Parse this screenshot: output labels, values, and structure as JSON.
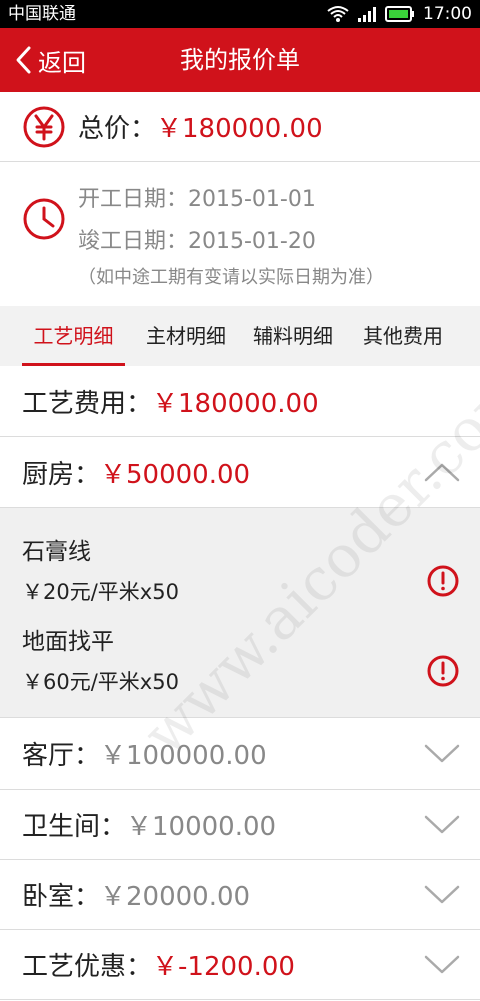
{
  "status_bar": {
    "carrier": "中国联通",
    "time": "17:00"
  },
  "nav": {
    "back_label": "返回",
    "title": "我的报价单"
  },
  "total": {
    "label": "总价：",
    "amount": "￥180000.00"
  },
  "dates": {
    "start": "开工日期：2015-01-01",
    "end": "竣工日期：2015-01-20",
    "note": "（如中途工期有变请以实际日期为准）"
  },
  "tabs": [
    {
      "label": "工艺明细",
      "active": true
    },
    {
      "label": "主材明细",
      "active": false
    },
    {
      "label": "辅料明细",
      "active": false
    },
    {
      "label": "其他费用",
      "active": false
    }
  ],
  "craft_fee": {
    "label": "工艺费用：",
    "amount": "￥180000.00"
  },
  "rooms": [
    {
      "label": "厨房：",
      "amount": "￥50000.00",
      "expanded": true
    },
    {
      "label": "客厅：",
      "amount": "￥100000.00",
      "expanded": false
    },
    {
      "label": "卫生间：",
      "amount": "￥10000.00",
      "expanded": false
    },
    {
      "label": "卧室：",
      "amount": "￥20000.00",
      "expanded": false
    }
  ],
  "kitchen_items": [
    {
      "name": "石膏线",
      "price": "￥20元/平米x50"
    },
    {
      "name": "地面找平",
      "price": "￥60元/平米x50"
    }
  ],
  "discount": {
    "label": "工艺优惠：",
    "amount": "￥-1200.00"
  },
  "watermark": "www.aicoder.com",
  "colors": {
    "brand_red": "#d0121b",
    "grey_text": "#888888"
  }
}
